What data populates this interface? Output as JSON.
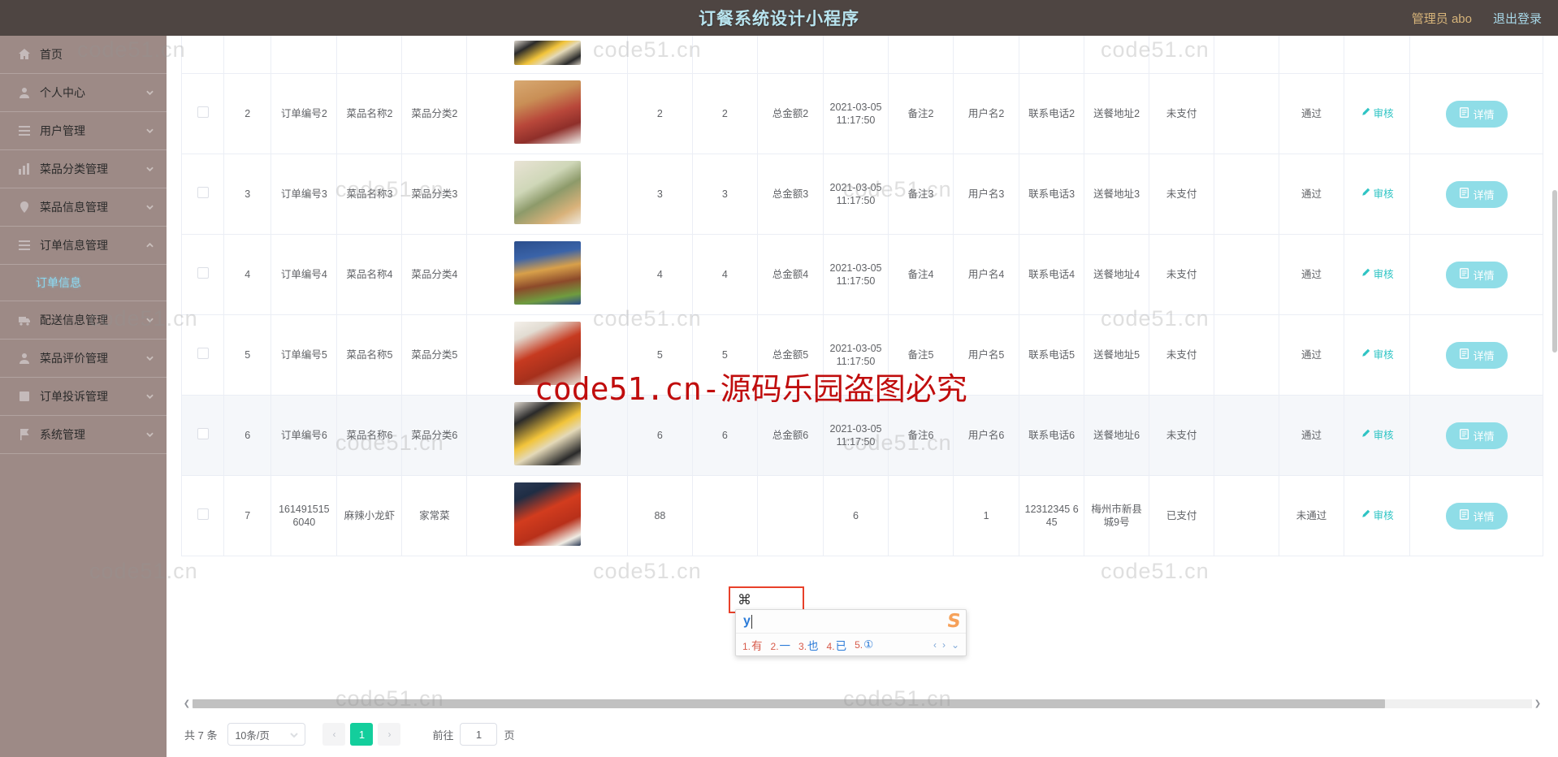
{
  "header": {
    "title": "订餐系统设计小程序",
    "admin_label": "管理员 abo",
    "logout_label": "退出登录"
  },
  "sidebar": {
    "items": [
      {
        "label": "首页",
        "icon": "home-icon",
        "expandable": false,
        "active": false
      },
      {
        "label": "个人中心",
        "icon": "user-icon",
        "expandable": true,
        "active": false
      },
      {
        "label": "用户管理",
        "icon": "list-icon",
        "expandable": true,
        "active": false
      },
      {
        "label": "菜品分类管理",
        "icon": "chart-icon",
        "expandable": true,
        "active": false
      },
      {
        "label": "菜品信息管理",
        "icon": "tag-icon",
        "expandable": true,
        "active": false
      },
      {
        "label": "订单信息管理",
        "icon": "list-icon",
        "expandable": true,
        "active": true
      },
      {
        "label": "配送信息管理",
        "icon": "truck-icon",
        "expandable": true,
        "active": false
      },
      {
        "label": "菜品评价管理",
        "icon": "user-icon",
        "expandable": true,
        "active": false
      },
      {
        "label": "订单投诉管理",
        "icon": "square-icon",
        "expandable": true,
        "active": false
      },
      {
        "label": "系统管理",
        "icon": "flag-icon",
        "expandable": true,
        "active": false
      }
    ],
    "submenu": {
      "parent": "订单信息管理",
      "label": "订单信息"
    }
  },
  "table": {
    "action_audit_label": "审核",
    "action_detail_label": "详情",
    "rows": [
      {
        "index": "2",
        "order_no": "订单编号2",
        "dish_name": "菜品名称2",
        "dish_category": "菜品分类2",
        "image": "dish-taco",
        "count": "2",
        "qty": "2",
        "total": "总金额2",
        "time": "2021-03-05 11:17:50",
        "remark": "备注2",
        "username": "用户名2",
        "phone": "联系电话2",
        "address": "送餐地址2",
        "pay_status": "未支付",
        "audit_status": "通过",
        "highlight": false
      },
      {
        "index": "3",
        "order_no": "订单编号3",
        "dish_name": "菜品名称3",
        "dish_category": "菜品分类3",
        "image": "dish-breakfast",
        "count": "3",
        "qty": "3",
        "total": "总金额3",
        "time": "2021-03-05 11:17:50",
        "remark": "备注3",
        "username": "用户名3",
        "phone": "联系电话3",
        "address": "送餐地址3",
        "pay_status": "未支付",
        "audit_status": "通过",
        "highlight": false
      },
      {
        "index": "4",
        "order_no": "订单编号4",
        "dish_name": "菜品名称4",
        "dish_category": "菜品分类4",
        "image": "dish-burger",
        "count": "4",
        "qty": "4",
        "total": "总金额4",
        "time": "2021-03-05 11:17:50",
        "remark": "备注4",
        "username": "用户名4",
        "phone": "联系电话4",
        "address": "送餐地址4",
        "pay_status": "未支付",
        "audit_status": "通过",
        "highlight": false
      },
      {
        "index": "5",
        "order_no": "订单编号5",
        "dish_name": "菜品名称5",
        "dish_category": "菜品分类5",
        "image": "dish-noodle",
        "count": "5",
        "qty": "5",
        "total": "总金额5",
        "time": "2021-03-05 11:17:50",
        "remark": "备注5",
        "username": "用户名5",
        "phone": "联系电话5",
        "address": "送餐地址5",
        "pay_status": "未支付",
        "audit_status": "通过",
        "highlight": false
      },
      {
        "index": "6",
        "order_no": "订单编号6",
        "dish_name": "菜品名称6",
        "dish_category": "菜品分类6",
        "image": "dish-bibimbap",
        "count": "6",
        "qty": "6",
        "total": "总金额6",
        "time": "2021-03-05 11:17:50",
        "remark": "备注6",
        "username": "用户名6",
        "phone": "联系电话6",
        "address": "送餐地址6",
        "pay_status": "未支付",
        "audit_status": "通过",
        "highlight": true
      },
      {
        "index": "7",
        "order_no": "161491515 6040",
        "dish_name": "麻辣小龙虾",
        "dish_category": "家常菜",
        "image": "dish-crayfish",
        "count": "88",
        "qty": "",
        "total": "",
        "time": "6",
        "remark": "",
        "username": "1",
        "phone": "12312345 645",
        "address": "梅州市新县城9号",
        "pay_status": "已支付",
        "audit_status": "未通过",
        "highlight": false
      }
    ]
  },
  "ime": {
    "typed": "y",
    "candidates": [
      {
        "index": "1.",
        "text": "有"
      },
      {
        "index": "2.",
        "text": "一"
      },
      {
        "index": "3.",
        "text": "也"
      },
      {
        "index": "4.",
        "text": "已"
      },
      {
        "index": "5.",
        "text": "①"
      }
    ],
    "prev_label": "‹",
    "next_label": "›",
    "more_label": "⌄",
    "logo": "S"
  },
  "footer": {
    "total_label": "共 7 条",
    "page_size_label": "10条/页",
    "prev_label": "‹",
    "next_label": "›",
    "current_page": "1",
    "goto_label": "前往",
    "goto_value": "1",
    "page_unit": "页"
  },
  "watermarks": {
    "small": "code51.cn",
    "center": "code51.cn-源码乐园盗图必究"
  },
  "colors": {
    "topbar_bg": "#4e4542",
    "topbar_title": "#b8e4ef",
    "sidebar_bg": "#9d8a86",
    "accent_cyan": "#2ec4c4",
    "detail_btn": "#8fdde7",
    "pager_active": "#13ce9c",
    "watermark_red": "#c00d0d"
  }
}
